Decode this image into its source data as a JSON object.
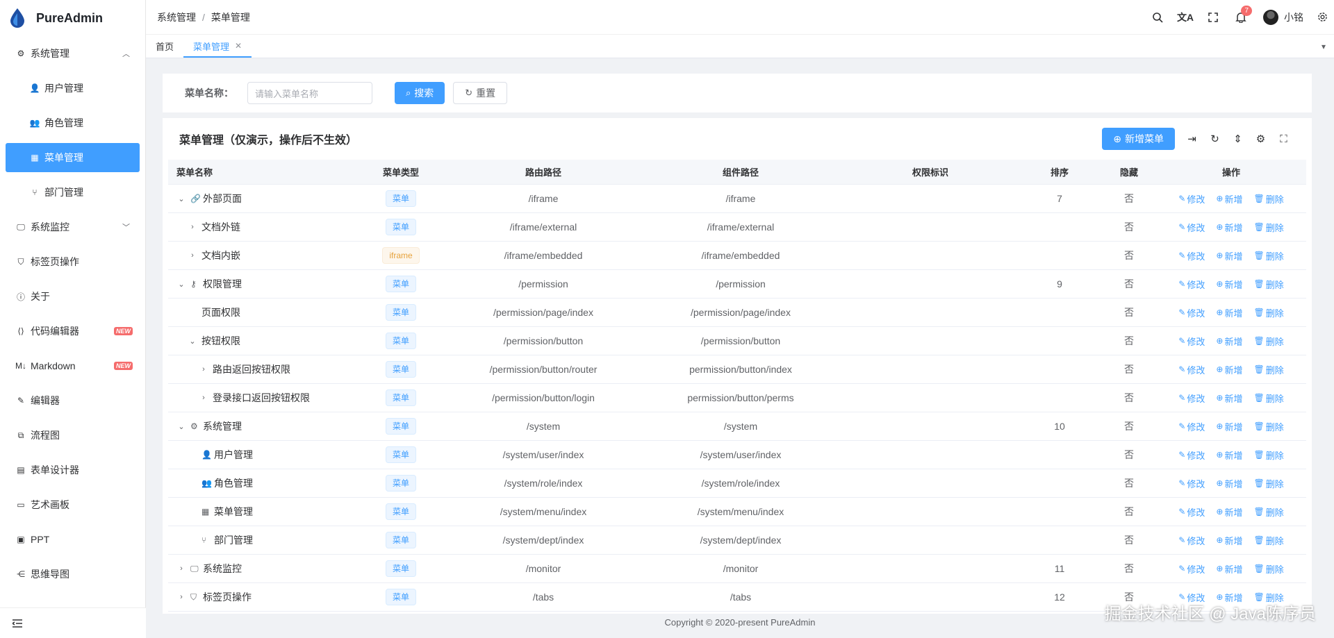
{
  "app": {
    "name": "PureAdmin"
  },
  "sidebar": {
    "items": [
      {
        "label": "系统管理",
        "icon": "gear-icon",
        "expanded": true
      },
      {
        "label": "用户管理",
        "icon": "user-icon",
        "sub": true
      },
      {
        "label": "角色管理",
        "icon": "role-icon",
        "sub": true
      },
      {
        "label": "菜单管理",
        "icon": "grid-icon",
        "sub": true,
        "active": true
      },
      {
        "label": "部门管理",
        "icon": "branch-icon",
        "sub": true
      },
      {
        "label": "系统监控",
        "icon": "monitor-icon",
        "collapsed": true
      },
      {
        "label": "标签页操作",
        "icon": "bookmark-icon"
      },
      {
        "label": "关于",
        "icon": "info-icon"
      },
      {
        "label": "代码编辑器",
        "icon": "code-icon",
        "badge": "NEW"
      },
      {
        "label": "Markdown",
        "icon": "markdown-icon",
        "badge": "NEW"
      },
      {
        "label": "编辑器",
        "icon": "edit-icon"
      },
      {
        "label": "流程图",
        "icon": "flow-icon"
      },
      {
        "label": "表单设计器",
        "icon": "form-icon"
      },
      {
        "label": "艺术画板",
        "icon": "board-icon"
      },
      {
        "label": "PPT",
        "icon": "ppt-icon"
      },
      {
        "label": "思维导图",
        "icon": "mindmap-icon"
      }
    ]
  },
  "header": {
    "breadcrumb": [
      "系统管理",
      "菜单管理"
    ],
    "bell_count": "7",
    "user_name": "小铭"
  },
  "tabs": [
    {
      "label": "首页",
      "active": false
    },
    {
      "label": "菜单管理",
      "active": true
    }
  ],
  "search": {
    "label": "菜单名称：",
    "placeholder": "请输入菜单名称",
    "search_label": "搜索",
    "reset_label": "重置"
  },
  "table": {
    "title": "菜单管理（仅演示，操作后不生效）",
    "add_label": "新增菜单",
    "columns": [
      "菜单名称",
      "菜单类型",
      "路由路径",
      "组件路径",
      "权限标识",
      "排序",
      "隐藏",
      "操作"
    ],
    "ops": {
      "edit": "修改",
      "add": "新增",
      "delete": "删除"
    },
    "rows": [
      {
        "indent": 0,
        "expander": "down",
        "icon": "link-icon",
        "name": "外部页面",
        "type": "菜单",
        "route": "/iframe",
        "comp": "/iframe",
        "perm": "",
        "sort": "7",
        "hidden": "否"
      },
      {
        "indent": 1,
        "expander": "right",
        "icon": "",
        "name": "文档外链",
        "type": "菜单",
        "route": "/iframe/external",
        "comp": "/iframe/external",
        "perm": "",
        "sort": "",
        "hidden": "否"
      },
      {
        "indent": 1,
        "expander": "right",
        "icon": "",
        "name": "文档内嵌",
        "type": "iframe",
        "route": "/iframe/embedded",
        "comp": "/iframe/embedded",
        "perm": "",
        "sort": "",
        "hidden": "否"
      },
      {
        "indent": 0,
        "expander": "down",
        "icon": "key-icon",
        "name": "权限管理",
        "type": "菜单",
        "route": "/permission",
        "comp": "/permission",
        "perm": "",
        "sort": "9",
        "hidden": "否"
      },
      {
        "indent": 1,
        "expander": "",
        "icon": "",
        "name": "页面权限",
        "type": "菜单",
        "route": "/permission/page/index",
        "comp": "/permission/page/index",
        "perm": "",
        "sort": "",
        "hidden": "否"
      },
      {
        "indent": 1,
        "expander": "down",
        "icon": "",
        "name": "按钮权限",
        "type": "菜单",
        "route": "/permission/button",
        "comp": "/permission/button",
        "perm": "",
        "sort": "",
        "hidden": "否"
      },
      {
        "indent": 2,
        "expander": "right",
        "icon": "",
        "name": "路由返回按钮权限",
        "type": "菜单",
        "route": "/permission/button/router",
        "comp": "permission/button/index",
        "perm": "",
        "sort": "",
        "hidden": "否"
      },
      {
        "indent": 2,
        "expander": "right",
        "icon": "",
        "name": "登录接口返回按钮权限",
        "type": "菜单",
        "route": "/permission/button/login",
        "comp": "permission/button/perms",
        "perm": "",
        "sort": "",
        "hidden": "否"
      },
      {
        "indent": 0,
        "expander": "down",
        "icon": "gear-icon",
        "name": "系统管理",
        "type": "菜单",
        "route": "/system",
        "comp": "/system",
        "perm": "",
        "sort": "10",
        "hidden": "否"
      },
      {
        "indent": 1,
        "expander": "",
        "icon": "user-icon",
        "name": "用户管理",
        "type": "菜单",
        "route": "/system/user/index",
        "comp": "/system/user/index",
        "perm": "",
        "sort": "",
        "hidden": "否"
      },
      {
        "indent": 1,
        "expander": "",
        "icon": "role-icon",
        "name": "角色管理",
        "type": "菜单",
        "route": "/system/role/index",
        "comp": "/system/role/index",
        "perm": "",
        "sort": "",
        "hidden": "否"
      },
      {
        "indent": 1,
        "expander": "",
        "icon": "grid-icon",
        "name": "菜单管理",
        "type": "菜单",
        "route": "/system/menu/index",
        "comp": "/system/menu/index",
        "perm": "",
        "sort": "",
        "hidden": "否"
      },
      {
        "indent": 1,
        "expander": "",
        "icon": "branch-icon",
        "name": "部门管理",
        "type": "菜单",
        "route": "/system/dept/index",
        "comp": "/system/dept/index",
        "perm": "",
        "sort": "",
        "hidden": "否"
      },
      {
        "indent": 0,
        "expander": "right",
        "icon": "monitor-icon",
        "name": "系统监控",
        "type": "菜单",
        "route": "/monitor",
        "comp": "/monitor",
        "perm": "",
        "sort": "11",
        "hidden": "否"
      },
      {
        "indent": 0,
        "expander": "right",
        "icon": "bookmark-icon",
        "name": "标签页操作",
        "type": "菜单",
        "route": "/tabs",
        "comp": "/tabs",
        "perm": "",
        "sort": "12",
        "hidden": "否"
      }
    ]
  },
  "footer": {
    "copyright": "Copyright © 2020-present PureAdmin"
  },
  "watermark": "掘金技术社区 @ Java陈序员",
  "colors": {
    "primary": "#409eff",
    "warning": "#e6a23c",
    "danger": "#f56c6c"
  }
}
